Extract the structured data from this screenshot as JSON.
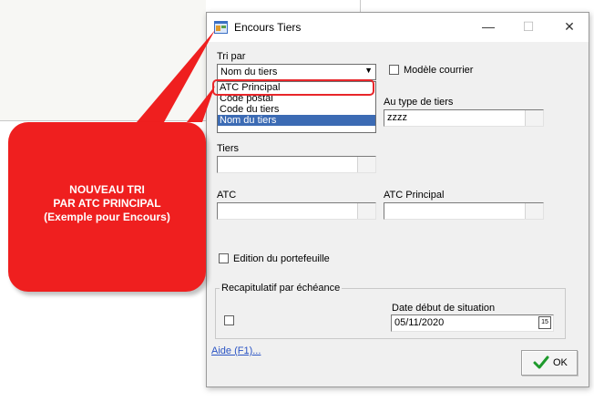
{
  "window": {
    "title": "Encours Tiers",
    "minimize": "—",
    "maximize": "☐",
    "close": "✕"
  },
  "sort": {
    "label": "Tri par",
    "selected": "Nom du tiers",
    "options": [
      "ATC Principal",
      "Code postal",
      "Code du tiers",
      "Nom du tiers"
    ]
  },
  "modele_courrier": {
    "label": "Modèle courrier",
    "checked": false
  },
  "type_tiers": {
    "label": "Au type de tiers",
    "value": "zzzz"
  },
  "tiers": {
    "label": "Tiers",
    "value": ""
  },
  "atc": {
    "label": "ATC",
    "value": ""
  },
  "atc_principal": {
    "label": "ATC Principal",
    "value": ""
  },
  "edition_portefeuille": {
    "label": "Edition du portefeuille",
    "checked": false
  },
  "recap": {
    "label": "Recapitulatif par échéance",
    "checked": false
  },
  "date_situation": {
    "label": "Date début de situation",
    "value": "05/11/2020",
    "calendar_label": "15"
  },
  "help_link": "Aide (F1)...",
  "ok_label": "OK",
  "callout": {
    "lines": [
      "NOUVEAU TRI",
      "PAR ATC PRINCIPAL",
      "(Exemple pour Encours)"
    ]
  },
  "colors": {
    "callout": "#ef1f1f",
    "selection": "#3c6bb4",
    "link": "#2b54c4",
    "ok_check": "#1e9a2c"
  },
  "icons": {
    "app": "app-window-icon",
    "ok": "checkmark-icon",
    "calendar": "calendar-icon"
  }
}
